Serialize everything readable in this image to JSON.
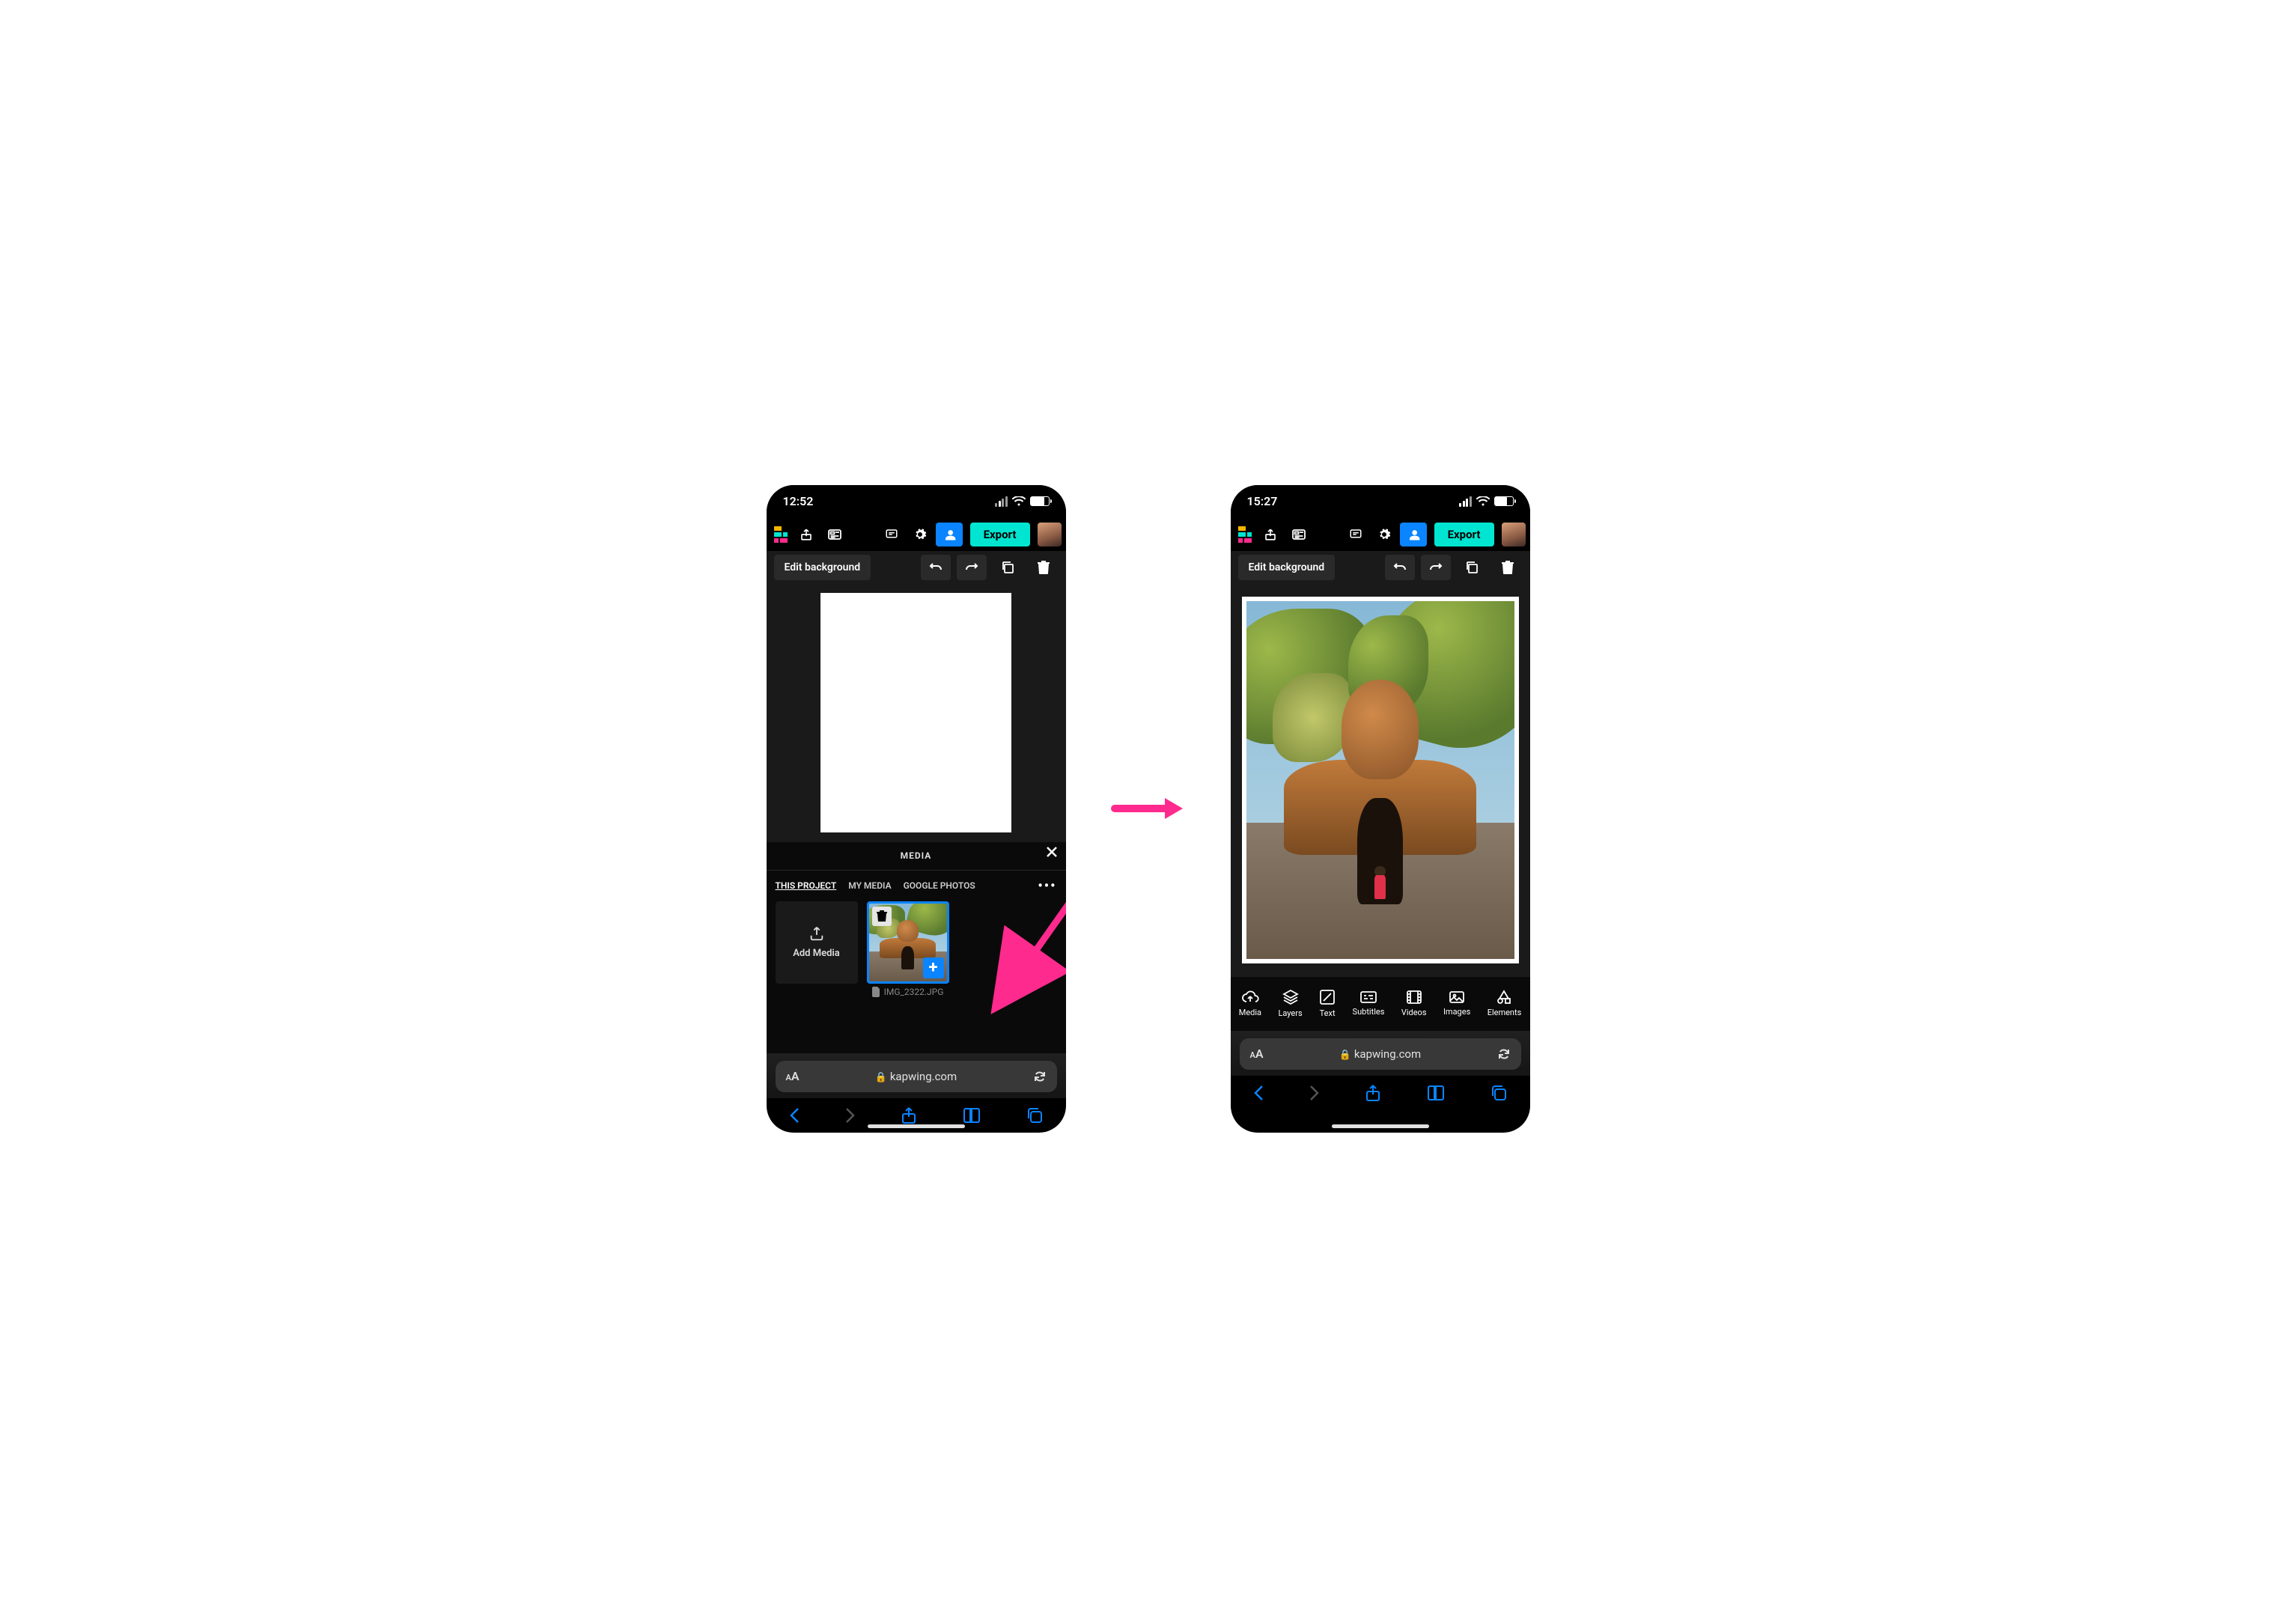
{
  "left": {
    "status": {
      "time": "12:52",
      "signal_bars": 2,
      "battery_pct": 78
    },
    "toolbar": {
      "export_label": "Export"
    },
    "edit": {
      "background_label": "Edit background"
    },
    "drawer": {
      "title": "MEDIA",
      "tabs": [
        "THIS PROJECT",
        "MY MEDIA",
        "GOOGLE PHOTOS"
      ],
      "active_tab": 0,
      "add_media_label": "Add Media",
      "thumb_filename": "IMG_2322.JPG"
    },
    "browser": {
      "domain": "kapwing.com"
    }
  },
  "right": {
    "status": {
      "time": "15:27",
      "signal_bars": 3,
      "battery_pct": 70
    },
    "toolbar": {
      "export_label": "Export"
    },
    "edit": {
      "background_label": "Edit background"
    },
    "bottom_tools": [
      {
        "id": "media",
        "label": "Media"
      },
      {
        "id": "layers",
        "label": "Layers"
      },
      {
        "id": "text",
        "label": "Text"
      },
      {
        "id": "subtitles",
        "label": "Subtitles"
      },
      {
        "id": "videos",
        "label": "Videos"
      },
      {
        "id": "images",
        "label": "Images"
      },
      {
        "id": "elements",
        "label": "Elements"
      }
    ],
    "browser": {
      "domain": "kapwing.com"
    }
  },
  "colors": {
    "accent_teal": "#00e5d1",
    "accent_blue": "#0a84ff",
    "arrow_pink": "#ff2a8d"
  }
}
